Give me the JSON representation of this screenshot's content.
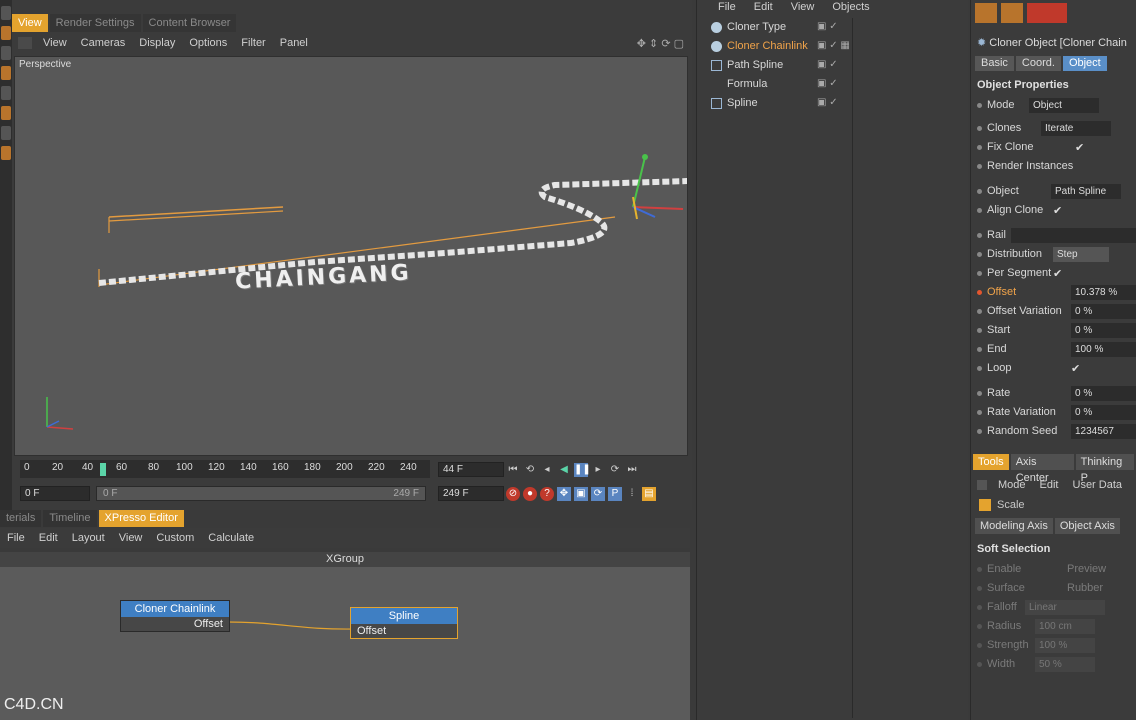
{
  "viewport": {
    "tabs": [
      "View",
      "Render Settings",
      "Content Browser"
    ],
    "menu": [
      "View",
      "Cameras",
      "Display",
      "Options",
      "Filter",
      "Panel"
    ],
    "label": "Perspective",
    "scene_text": "CHAINGANG"
  },
  "timeline": {
    "ticks": [
      "0",
      "20",
      "40",
      "60",
      "80",
      "100",
      "120",
      "140",
      "160",
      "180",
      "200",
      "220",
      "240"
    ],
    "current_frame": "44 F",
    "start_frame": "0 F",
    "range_start": "0 F",
    "range_end": "249 F",
    "end_frame": "249 F"
  },
  "xpresso": {
    "tabs": [
      "terials",
      "Timeline",
      "XPresso Editor"
    ],
    "menu": [
      "File",
      "Edit",
      "Layout",
      "View",
      "Custom",
      "Calculate"
    ],
    "group_title": "XGroup",
    "node1": {
      "title": "Cloner Chainlink",
      "port": "Offset"
    },
    "node2": {
      "title": "Spline",
      "port": "Offset"
    }
  },
  "watermark": "C4D.CN",
  "object_manager": {
    "menu": [
      "File",
      "Edit",
      "View",
      "Objects"
    ],
    "items": [
      {
        "name": "Cloner Type",
        "selected": false
      },
      {
        "name": "Cloner Chainlink",
        "selected": true
      },
      {
        "name": "Path Spline",
        "selected": false
      },
      {
        "name": "Formula",
        "selected": false
      },
      {
        "name": "Spline",
        "selected": false
      }
    ]
  },
  "attributes": {
    "title": "Cloner Object [Cloner Chain",
    "tabs": [
      "Basic",
      "Coord.",
      "Object"
    ],
    "section": "Object Properties",
    "rows": [
      {
        "label": "Mode",
        "value": "Object"
      },
      {
        "label": "Clones",
        "value": "Iterate"
      },
      {
        "label": "Fix Clone",
        "check": "✔"
      },
      {
        "label": "Render Instances",
        "check": ""
      },
      {
        "label": "Object",
        "value": "Path Spline"
      },
      {
        "label": "Align Clone",
        "check": "✔"
      },
      {
        "label": "Rail",
        "value": ""
      },
      {
        "label": "Distribution",
        "value": "Step"
      },
      {
        "label": "Per Segment",
        "check": "✔"
      },
      {
        "label": "Offset",
        "value": "10.378 %",
        "highlight": true
      },
      {
        "label": "Offset Variation",
        "value": "0 %"
      },
      {
        "label": "Start",
        "value": "0 %"
      },
      {
        "label": "End",
        "value": "100 %"
      },
      {
        "label": "Loop",
        "check": "✔"
      },
      {
        "label": "Rate",
        "value": "0 %"
      },
      {
        "label": "Rate Variation",
        "value": "0 %"
      },
      {
        "label": "Random Seed",
        "value": "1234567"
      }
    ],
    "tools_tabs": [
      "Tools",
      "Axis Center",
      "Thinking P"
    ],
    "tools_menu": [
      "Mode",
      "Edit",
      "User Data"
    ],
    "scale_label": "Scale",
    "axis_tabs": [
      "Modeling Axis",
      "Object Axis"
    ],
    "soft_selection": "Soft Selection",
    "soft_rows": [
      {
        "label": "Enable",
        "right": "Preview"
      },
      {
        "label": "Surface",
        "right": "Rubber"
      },
      {
        "label": "Falloff",
        "value": "Linear"
      },
      {
        "label": "Radius",
        "value": "100 cm"
      },
      {
        "label": "Strength",
        "value": "100 %"
      },
      {
        "label": "Width",
        "value": "50 %"
      }
    ]
  }
}
